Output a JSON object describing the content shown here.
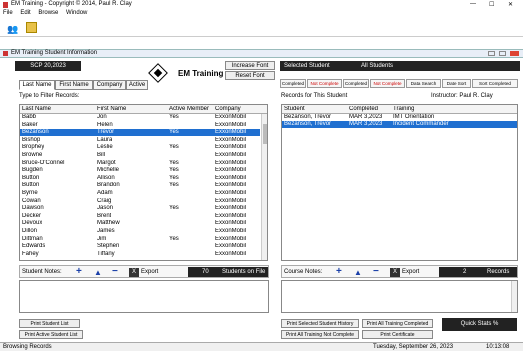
{
  "window": {
    "title": "EM Training - Copyright © 2014, Paul R. Clay",
    "controls": [
      "—",
      "☐",
      "✕"
    ]
  },
  "menu": [
    "File",
    "Edit",
    "Browse",
    "Window"
  ],
  "inner_title": "EM Training Student Information",
  "left": {
    "scp_code": "SCP 20,2023",
    "logo_text": "EM Training",
    "increase_font": "Increase Font",
    "reset_font": "Reset Font",
    "tabs": [
      "Last Name",
      "First Name",
      "Company",
      "Active"
    ],
    "filter_label": "Type to Filter Records:",
    "columns": [
      "Last Name",
      "First Name",
      "Active Member",
      "Company"
    ],
    "rows": [
      [
        "Babb",
        "Jon",
        "Yes",
        "ExxonMobil"
      ],
      [
        "Baker",
        "Helen",
        "",
        "ExxonMobil"
      ],
      [
        "Bezanson",
        "Trevor",
        "Yes",
        "ExxonMobil"
      ],
      [
        "Bishop",
        "Laura",
        "",
        "ExxonMobil"
      ],
      [
        "Brophey",
        "Leslie",
        "Yes",
        "ExxonMobil"
      ],
      [
        "Browne",
        "Bill",
        "",
        "ExxonMobil"
      ],
      [
        "Bruce-O'Connel",
        "Margot",
        "Yes",
        "ExxonMobil"
      ],
      [
        "Bugden",
        "Michelle",
        "Yes",
        "ExxonMobil"
      ],
      [
        "Button",
        "Allison",
        "Yes",
        "ExxonMobil"
      ],
      [
        "Button",
        "Brandon",
        "Yes",
        "ExxonMobil"
      ],
      [
        "Byrne",
        "Adam",
        "",
        "ExxonMobil"
      ],
      [
        "Cowan",
        "Craig",
        "",
        "ExxonMobil"
      ],
      [
        "Dawson",
        "Jason",
        "Yes",
        "ExxonMobil"
      ],
      [
        "Decker",
        "Brent",
        "",
        "ExxonMobil"
      ],
      [
        "Devoux",
        "Matthew",
        "",
        "ExxonMobil"
      ],
      [
        "Dillon",
        "James",
        "",
        "ExxonMobil"
      ],
      [
        "Dittman",
        "Jim",
        "Yes",
        "ExxonMobil"
      ],
      [
        "Edwards",
        "Stephen",
        "",
        "ExxonMobil"
      ],
      [
        "Fahey",
        "Tiffany",
        "",
        "ExxonMobil"
      ]
    ],
    "selected_row": 2,
    "student_notes": "Student Notes:",
    "export": "Export",
    "count": "70",
    "count_label": "Students on File",
    "print_list": "Print Student List",
    "print_active": "Print Active Student List"
  },
  "right": {
    "selected_student": "Selected Student",
    "all_students": "All Students",
    "tabs": [
      {
        "label": "Completed",
        "red": false
      },
      {
        "label": "Not Complete",
        "red": true
      },
      {
        "label": "Completed",
        "red": false
      },
      {
        "label": "Not Complete",
        "red": true
      },
      {
        "label": "Data Search",
        "red": false
      },
      {
        "label": "Date Sort",
        "red": false
      },
      {
        "label": "Sort Completed",
        "red": false
      }
    ],
    "records_label": "Records for This Student",
    "instructor": "Instructor: Paul R. Clay",
    "columns": [
      "Student",
      "Completed",
      "Training"
    ],
    "rows": [
      [
        "Bezanson, Trevor",
        "MAR 3,2023",
        "IMT Orientation"
      ],
      [
        "Bezanson, Trevor",
        "MAR 3,2023",
        "Incident Commander"
      ]
    ],
    "selected_row": 1,
    "course_notes": "Course Notes:",
    "export": "Export",
    "count": "2",
    "count_label": "Records",
    "print_history": "Print Selected Student History",
    "print_all_completed": "Print All Training Completed",
    "quick_stats": "Quick Stats %",
    "print_not_complete": "Print All Training Not Complete",
    "print_certificate": "Print Certificate"
  },
  "status": {
    "left": "Browsing Records",
    "date": "Tuesday, September 26, 2023",
    "time": "10:13:08"
  }
}
